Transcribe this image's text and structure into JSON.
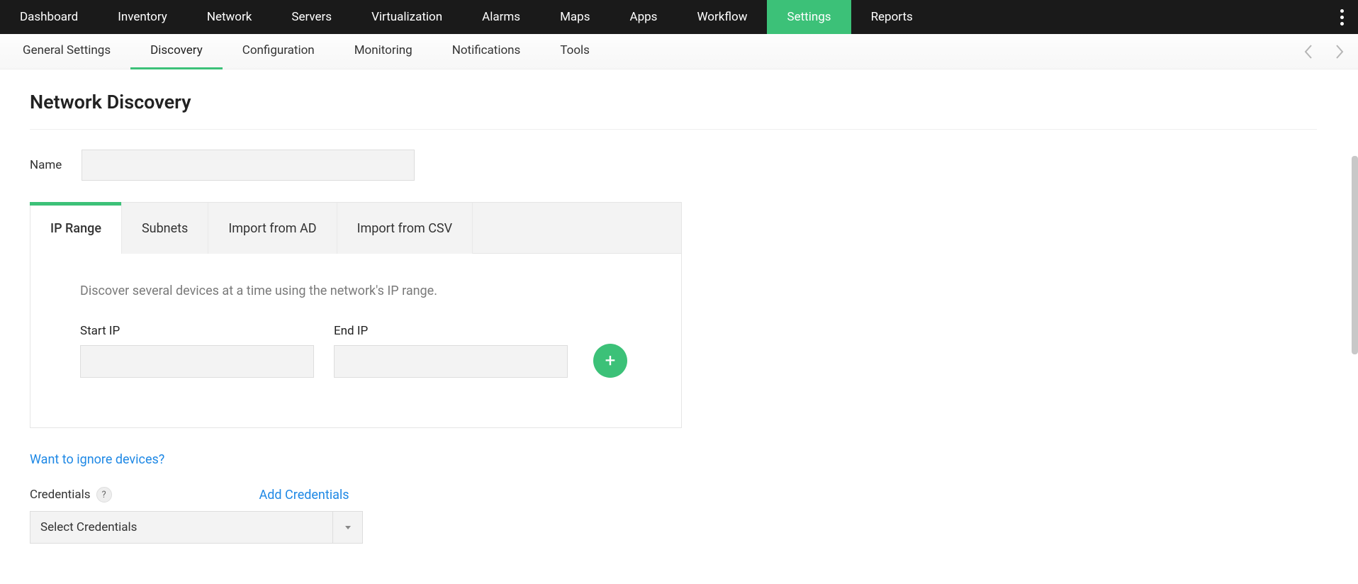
{
  "topnav": {
    "items": [
      {
        "label": "Dashboard"
      },
      {
        "label": "Inventory"
      },
      {
        "label": "Network"
      },
      {
        "label": "Servers"
      },
      {
        "label": "Virtualization"
      },
      {
        "label": "Alarms"
      },
      {
        "label": "Maps"
      },
      {
        "label": "Apps"
      },
      {
        "label": "Workflow"
      },
      {
        "label": "Settings",
        "active": true
      },
      {
        "label": "Reports"
      }
    ]
  },
  "subnav": {
    "items": [
      {
        "label": "General Settings"
      },
      {
        "label": "Discovery",
        "active": true
      },
      {
        "label": "Configuration"
      },
      {
        "label": "Monitoring"
      },
      {
        "label": "Notifications"
      },
      {
        "label": "Tools"
      }
    ]
  },
  "page": {
    "title": "Network Discovery",
    "name_label": "Name",
    "name_value": ""
  },
  "tabs": {
    "items": [
      {
        "label": "IP Range",
        "active": true
      },
      {
        "label": "Subnets"
      },
      {
        "label": "Import from AD"
      },
      {
        "label": "Import from CSV"
      }
    ],
    "helper": "Discover several devices at a time using the network's IP range.",
    "start_ip_label": "Start IP",
    "start_ip_value": "",
    "end_ip_label": "End IP",
    "end_ip_value": "",
    "add_icon": "+"
  },
  "links": {
    "ignore_devices": "Want to ignore devices?",
    "add_credentials": "Add Credentials"
  },
  "credentials": {
    "label": "Credentials",
    "help": "?",
    "select_placeholder": "Select Credentials"
  }
}
